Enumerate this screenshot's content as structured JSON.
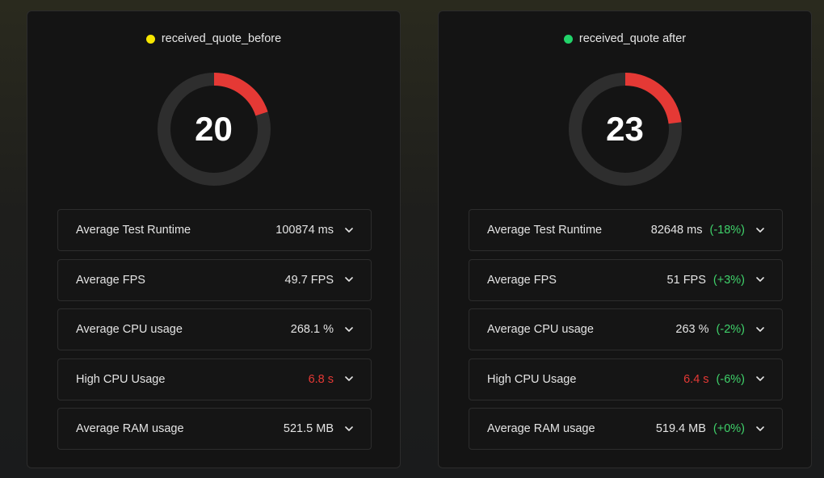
{
  "panels": [
    {
      "title": "received_quote_before",
      "dot_color": "#f7e600",
      "score": "20",
      "score_fraction": 0.2,
      "metrics": [
        {
          "label": "Average Test Runtime",
          "value": "100874 ms",
          "delta": "",
          "value_color": "normal"
        },
        {
          "label": "Average FPS",
          "value": "49.7 FPS",
          "delta": "",
          "value_color": "normal"
        },
        {
          "label": "Average CPU usage",
          "value": "268.1 %",
          "delta": "",
          "value_color": "normal"
        },
        {
          "label": "High CPU Usage",
          "value": "6.8 s",
          "delta": "",
          "value_color": "red"
        },
        {
          "label": "Average RAM usage",
          "value": "521.5 MB",
          "delta": "",
          "value_color": "normal"
        }
      ]
    },
    {
      "title": "received_quote after",
      "dot_color": "#22d36a",
      "score": "23",
      "score_fraction": 0.23,
      "metrics": [
        {
          "label": "Average Test Runtime",
          "value": "82648 ms",
          "delta": "(-18%)",
          "value_color": "normal"
        },
        {
          "label": "Average FPS",
          "value": "51 FPS",
          "delta": "(+3%)",
          "value_color": "normal"
        },
        {
          "label": "Average CPU usage",
          "value": "263 %",
          "delta": "(-2%)",
          "value_color": "normal"
        },
        {
          "label": "High CPU Usage",
          "value": "6.4 s",
          "delta": "(-6%)",
          "value_color": "red"
        },
        {
          "label": "Average RAM usage",
          "value": "519.4 MB",
          "delta": "(+0%)",
          "value_color": "normal"
        }
      ]
    }
  ],
  "colors": {
    "gauge_track": "#2e2e2e",
    "gauge_fill": "#e53935",
    "delta_good": "#3fd16a",
    "value_bad": "#e53935"
  },
  "icons": {
    "expand": "chevron-down-icon",
    "status": "status-dot-icon"
  }
}
